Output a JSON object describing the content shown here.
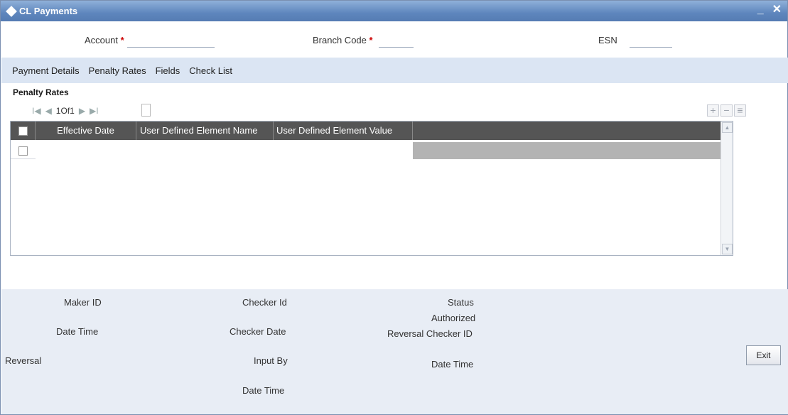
{
  "window": {
    "title": "CL Payments",
    "minimize_label": "_",
    "close_label": "✕"
  },
  "header": {
    "account_label": "Account",
    "branch_label": "Branch Code",
    "esn_label": "ESN",
    "required_mark": "*",
    "account_value": "",
    "branch_value": "",
    "esn_value": ""
  },
  "tabs": [
    {
      "label": "Payment Details"
    },
    {
      "label": "Penalty Rates"
    },
    {
      "label": "Fields"
    },
    {
      "label": "Check List"
    }
  ],
  "section": {
    "title": "Penalty Rates"
  },
  "pager": {
    "first": "I◀",
    "prev": "◀",
    "text": "1Of1",
    "next": "▶",
    "last": "▶I"
  },
  "grid_tools": {
    "add": "+",
    "remove": "−",
    "view": "≡"
  },
  "grid": {
    "columns": [
      "Effective Date",
      "User Defined Element Name",
      "User Defined Element Value"
    ]
  },
  "footer": {
    "maker_id": "Maker ID",
    "date_time_1": "Date Time",
    "reversal": "Reversal",
    "checker_id": "Checker Id",
    "checker_date": "Checker Date",
    "input_by": "Input By",
    "date_time_2": "Date Time",
    "status": "Status",
    "authorized": "Authorized",
    "reversal_checker_id": "Reversal Checker ID",
    "date_time_3": "Date Time",
    "exit_label": "Exit"
  }
}
